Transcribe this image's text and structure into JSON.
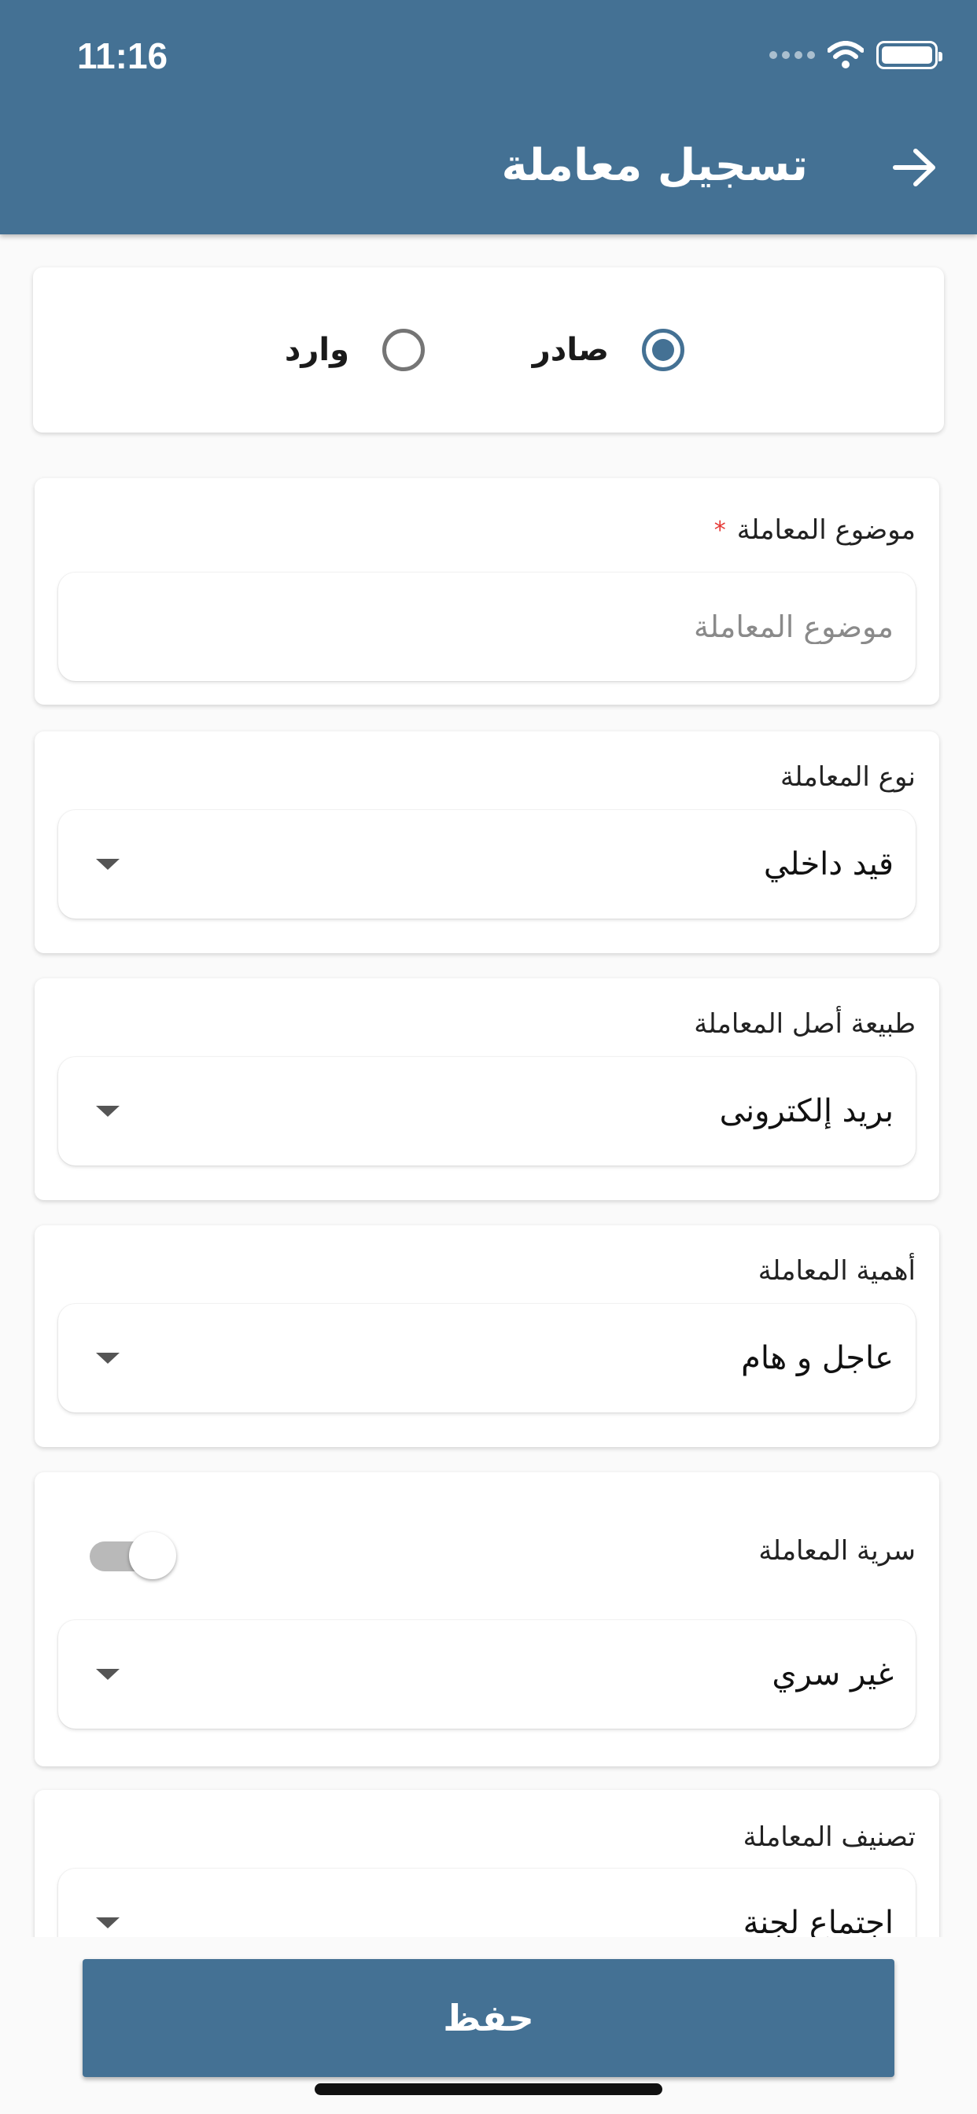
{
  "status_bar": {
    "time": "11:16"
  },
  "header": {
    "title": "تسجيل معاملة",
    "back_icon": "arrow-right-icon"
  },
  "direction": {
    "options": [
      {
        "label": "صادر",
        "selected": true
      },
      {
        "label": "وارد",
        "selected": false
      }
    ]
  },
  "form": {
    "subject": {
      "label": "موضوع المعاملة",
      "required_mark": "*",
      "placeholder": "موضوع المعاملة",
      "value": ""
    },
    "type": {
      "label": "نوع المعاملة",
      "value": "قيد داخلي"
    },
    "origin": {
      "label": "طبيعة أصل المعاملة",
      "value": "بريد إلكترونى"
    },
    "importance": {
      "label": "أهمية المعاملة",
      "value": "عاجل و هام"
    },
    "confidentiality": {
      "label": "سرية المعاملة",
      "toggle_on": false,
      "value": "غير سري"
    },
    "classification": {
      "label": "تصنيف المعاملة",
      "value": "اجتماع لجنة"
    }
  },
  "actions": {
    "save_label": "حفظ"
  },
  "colors": {
    "primary": "#447194",
    "background": "#fafafa",
    "required": "#e53935"
  }
}
